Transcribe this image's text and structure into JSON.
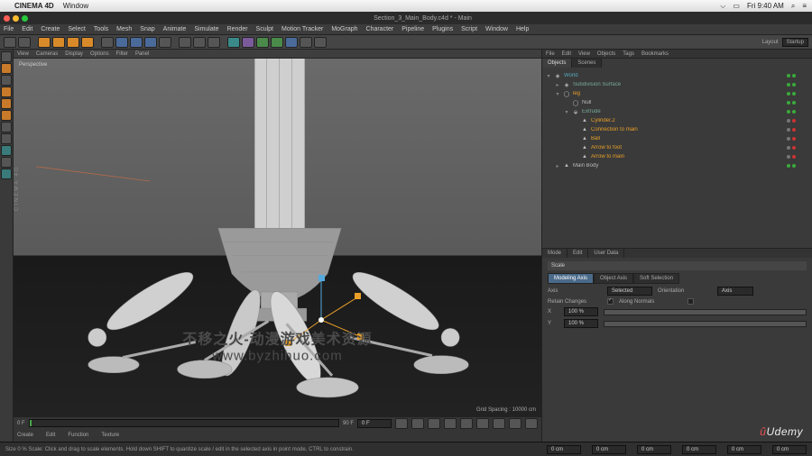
{
  "mac": {
    "app": "CINEMA 4D",
    "menu": "Window",
    "clock": "Fri 9:40 AM"
  },
  "window_title": "Section_3_Main_Body.c4d * - Main",
  "menus": [
    "File",
    "Edit",
    "Create",
    "Select",
    "Tools",
    "Mesh",
    "Snap",
    "Animate",
    "Simulate",
    "Render",
    "Sculpt",
    "Motion Tracker",
    "MoGraph",
    "Character",
    "Pipeline",
    "Plugins",
    "Script",
    "Window",
    "Help"
  ],
  "layout": {
    "label": "Layout",
    "value": "Startup"
  },
  "vp_menu": [
    "View",
    "Cameras",
    "Display",
    "Options",
    "Filter",
    "Panel"
  ],
  "vp_label": "Perspective",
  "grid_spacing": "Grid Spacing : 10000 cm",
  "timeline": {
    "start": "0 F",
    "end": "90 F",
    "cur": "0 F",
    "tabs": [
      "Create",
      "Edit",
      "Function",
      "Texture"
    ]
  },
  "om": {
    "header": [
      "File",
      "Edit",
      "View",
      "Objects",
      "Tags",
      "Bookmarks"
    ],
    "tabs": [
      "Objects",
      "Scenes"
    ],
    "items": [
      {
        "indent": 0,
        "tw": "▾",
        "icon": "◈",
        "name": "World",
        "hl": "hlcyan",
        "dots": [
          "d-green",
          "d-green"
        ]
      },
      {
        "indent": 1,
        "tw": "▸",
        "icon": "◈",
        "name": "Subdivision Surface",
        "hl": "hlgreen",
        "dots": [
          "d-green",
          "d-green"
        ]
      },
      {
        "indent": 1,
        "tw": "▾",
        "icon": "◯",
        "name": "leg",
        "hl": "highlight",
        "dots": [
          "d-green",
          "d-green"
        ]
      },
      {
        "indent": 2,
        "tw": "",
        "icon": "◯",
        "name": "Null",
        "hl": "",
        "dots": [
          "d-green",
          "d-green"
        ]
      },
      {
        "indent": 2,
        "tw": "▾",
        "icon": "⬙",
        "name": "Extrude",
        "hl": "hlgreen",
        "dots": [
          "d-green",
          "d-green"
        ]
      },
      {
        "indent": 3,
        "tw": "",
        "icon": "▲",
        "name": "Cylinder.2",
        "hl": "highlight",
        "dots": [
          "d-grey",
          "d-red"
        ]
      },
      {
        "indent": 3,
        "tw": "",
        "icon": "▲",
        "name": "Connection to main",
        "hl": "highlight",
        "dots": [
          "d-grey",
          "d-red"
        ]
      },
      {
        "indent": 3,
        "tw": "",
        "icon": "▲",
        "name": "Ball",
        "hl": "highlight",
        "dots": [
          "d-grey",
          "d-red"
        ]
      },
      {
        "indent": 3,
        "tw": "",
        "icon": "▲",
        "name": "Arrow to foot",
        "hl": "highlight",
        "dots": [
          "d-grey",
          "d-red"
        ]
      },
      {
        "indent": 3,
        "tw": "",
        "icon": "▲",
        "name": "Arrow to main",
        "hl": "highlight",
        "dots": [
          "d-grey",
          "d-red"
        ]
      },
      {
        "indent": 1,
        "tw": "▸",
        "icon": "▲",
        "name": "Main Body",
        "hl": "",
        "dots": [
          "d-green",
          "d-green"
        ]
      }
    ]
  },
  "attr": {
    "tabs": [
      "Mode",
      "Edit",
      "User Data"
    ],
    "title": "Scale",
    "tabs2": [
      "Modeling Axis",
      "Object Axis",
      "Soft Selection"
    ],
    "rows": {
      "axis_label": "Axis",
      "axis_value": "Selected",
      "orientation_label": "Orientation",
      "orientation_value": "Axis",
      "retain_label": "Retain Changes",
      "keep_label": "Along Normals",
      "x_label": "X",
      "x_val": "100 %",
      "y_label": "Y",
      "y_val": "100 %"
    }
  },
  "status": {
    "hint": "Size 0 %   Scale: Click and drag to scale elements. Hold down SHIFT to quantize scale / edit in the selected axis in point mode, CTRL to constrain.",
    "fields": [
      "0 cm",
      "0 cm",
      "0 cm",
      "0 cm",
      "0 cm",
      "0 cm"
    ]
  },
  "watermark": {
    "l1": "不移之火-动漫游戏美术资源",
    "l2": "www.byzhihuo.com"
  },
  "udemy": "Udemy"
}
